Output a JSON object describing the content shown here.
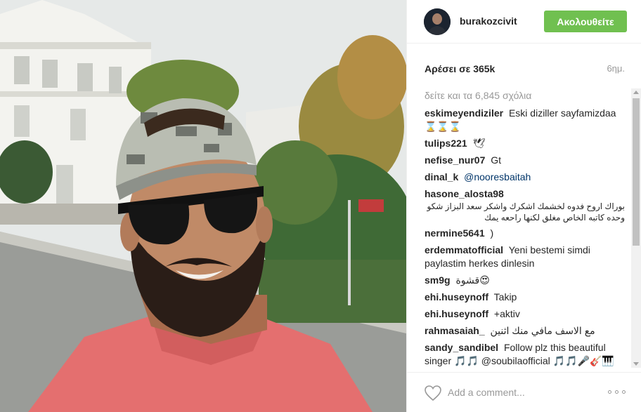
{
  "post": {
    "image_alt": "selfie"
  },
  "header": {
    "username": "burakozcivit",
    "follow_label": "Ακολουθείτε"
  },
  "stats": {
    "likes": "Αρέσει σε 365k",
    "time": "6ημ."
  },
  "comments": {
    "view_all": "δείτε και τα 6,845 σχόλια",
    "items": [
      {
        "user": "eskimeyendiziler",
        "text": "Eski diziller sayfamizdaa ⌛⌛⌛"
      },
      {
        "user": "tulips221",
        "text": "🕊"
      },
      {
        "user": "nefise_nur07",
        "text": "Gt"
      },
      {
        "user": "dinal_k",
        "text": "@nooresbaitah"
      },
      {
        "user": "hasone_alosta98",
        "text": "بوراك اروح فدوه لخشمك اشكرك واشكر سعد البزاز شكو وحده كاتبه الخاص مغلق لكنها راحعه يمك"
      },
      {
        "user": "nermine5641",
        "text": ")"
      },
      {
        "user": "erdemmatofficial",
        "text": "Yeni bestemi simdi paylastim herkes dinlesin"
      },
      {
        "user": "sm9g",
        "text": "قشوة😍"
      },
      {
        "user": "ehi.huseynoff",
        "text": "Takip"
      },
      {
        "user": "ehi.huseynoff",
        "text": "+aktiv"
      },
      {
        "user": "rahmasaiah_",
        "text": "مع الاسف مافي منك اثنين"
      },
      {
        "user": "sandy_sandibel",
        "text": "Follow plz this beautiful singer 🎵🎵 @soubilaofficial 🎵🎵🎤🎸🎹"
      }
    ]
  },
  "footer": {
    "comment_placeholder": "Add a comment...",
    "more_label": "ooo"
  },
  "colors": {
    "follow_green": "#70c050",
    "mention_blue": "#003569",
    "muted_gray": "#999999"
  },
  "icons": {
    "like": "heart-icon",
    "more": "more-options-icon"
  }
}
